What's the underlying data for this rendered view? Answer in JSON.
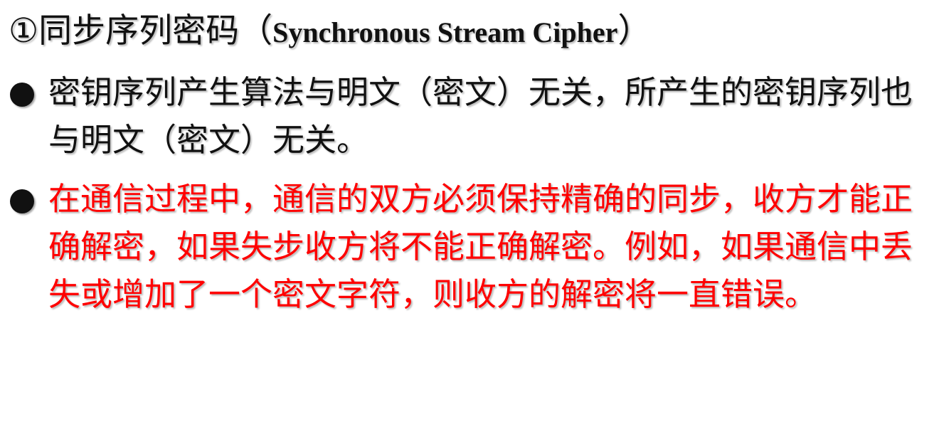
{
  "slide": {
    "title_prefix": "①同步序列密码（",
    "title_latin": "Synchronous Stream Cipher",
    "title_suffix": "）",
    "bullets": [
      {
        "text": "密钥序列产生算法与明文（密文）无关，所产生的密钥序列也与明文（密文）无关。",
        "color": "#111111"
      },
      {
        "text": "在通信过程中，通信的双方必须保持精确的同步，收方才能正确解密，如果失步收方将不能正确解密。例如，如果通信中丢失或增加了一个密文字符，则收方的解密将一直错误。",
        "color": "#ff0000"
      }
    ]
  }
}
